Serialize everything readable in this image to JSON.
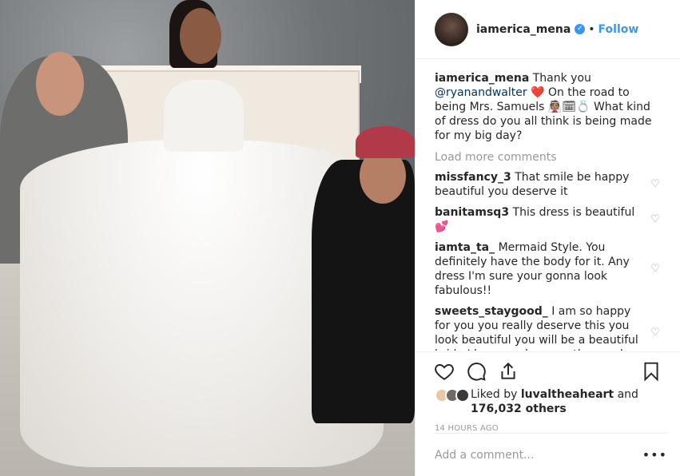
{
  "header": {
    "username": "iamerica_mena",
    "verified_icon": "verified-badge-icon",
    "separator": "•",
    "follow_label": "Follow"
  },
  "caption": {
    "username": "iamerica_mena",
    "pre_mention": "Thank you",
    "mention": "@ryanandwalter",
    "text": "❤️ On the road to being Mrs. Samuels 👰🏽🗓💍 What kind of dress do you all think is being made for my big day?"
  },
  "load_more": "Load more comments",
  "comments": [
    {
      "username": "missfancy_3",
      "text": "That smile be happy beautiful you deserve it"
    },
    {
      "username": "banitamsq3",
      "text": "This dress is beautiful 💕"
    },
    {
      "username": "iamta_ta_",
      "text": "Mermaid Style. You definitely have the body for it. Any dress I'm sure your gonna look fabulous!!"
    },
    {
      "username": "sweets_staygood_",
      "text": "I am so happy for you you really deserve this you look beautiful you will be a beautiful bride I love you keep up the good"
    }
  ],
  "actions": {
    "like_icon": "heart-icon",
    "comment_icon": "comment-icon",
    "share_icon": "share-icon",
    "save_icon": "bookmark-icon"
  },
  "likes": {
    "prefix": "Liked by",
    "user": "luvaltheaheart",
    "connector": "and",
    "count": "176,032 others"
  },
  "timestamp": "14 HOURS AGO",
  "add_comment": {
    "placeholder": "Add a comment...",
    "more_label": "•••"
  }
}
